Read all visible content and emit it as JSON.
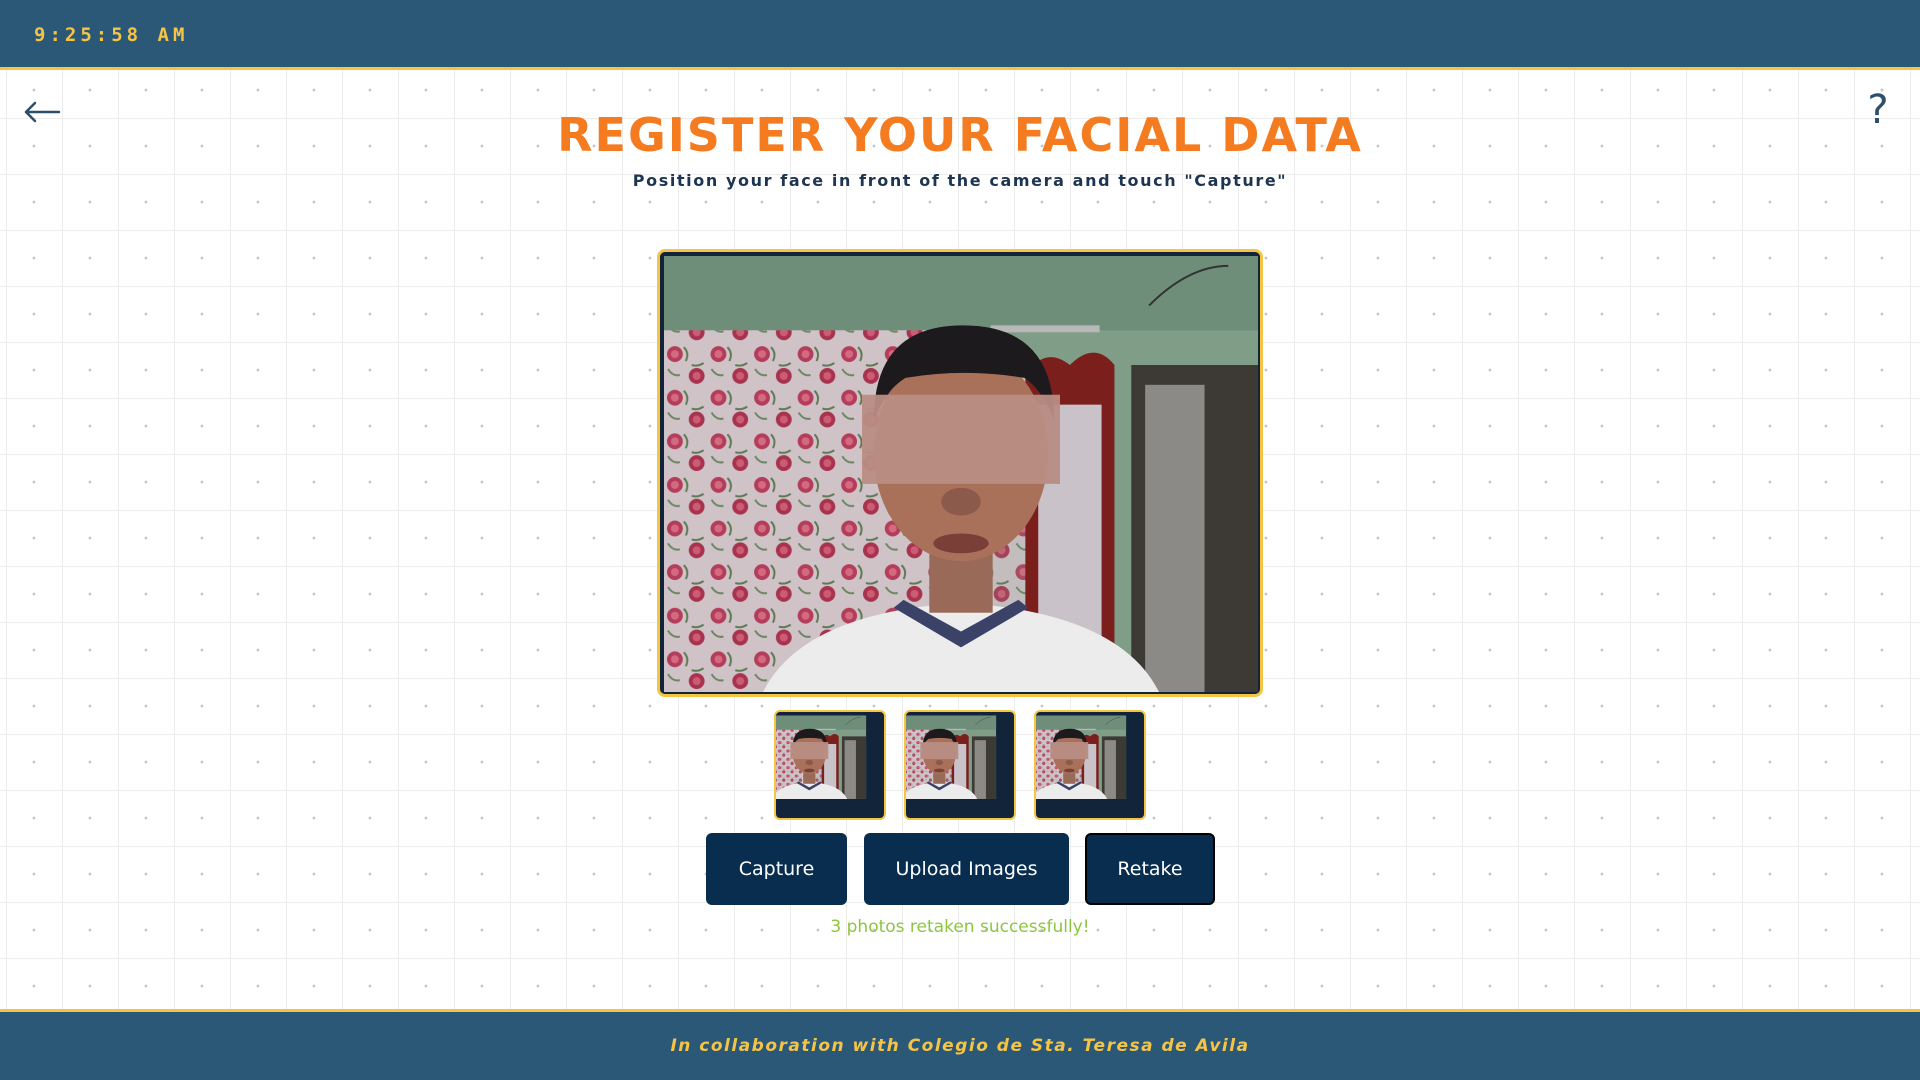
{
  "header": {
    "clock": "9:25:58 AM"
  },
  "nav": {
    "back_icon": "arrow-left-icon",
    "help_label": "?"
  },
  "page": {
    "title": "REGISTER YOUR FACIAL DATA",
    "subtitle": "Position your face in front of the camera and touch \"Capture\""
  },
  "camera": {
    "thumbnail_count": 3
  },
  "actions": {
    "capture_label": "Capture",
    "upload_label": "Upload Images",
    "retake_label": "Retake"
  },
  "status": {
    "message": "3 photos retaken successfully!"
  },
  "footer": {
    "text": "In collaboration with Colegio de Sta. Teresa de Avila"
  },
  "colors": {
    "bar": "#2c5878",
    "accent_yellow": "#f5c445",
    "title_orange": "#f47b20",
    "button_navy": "#082d4f",
    "success_green": "#8cc63f"
  }
}
